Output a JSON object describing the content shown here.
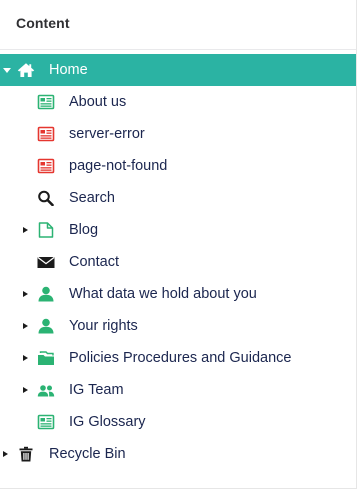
{
  "panel": {
    "title": "Content"
  },
  "tree": {
    "home": {
      "label": "Home",
      "icon": "home-icon",
      "expanded": true,
      "selected": true
    },
    "children": [
      {
        "label": "About us",
        "icon": "page-icon"
      },
      {
        "label": "server-error",
        "icon": "error-page-icon"
      },
      {
        "label": "page-not-found",
        "icon": "error-page-icon"
      },
      {
        "label": "Search",
        "icon": "search-icon"
      },
      {
        "label": "Blog",
        "icon": "document-icon",
        "has_children": true
      },
      {
        "label": "Contact",
        "icon": "envelope-icon"
      },
      {
        "label": "What data we hold about you",
        "icon": "user-icon",
        "has_children": true
      },
      {
        "label": "Your rights",
        "icon": "user-icon",
        "has_children": true
      },
      {
        "label": "Policies Procedures and Guidance",
        "icon": "folder-icon",
        "has_children": true
      },
      {
        "label": "IG Team",
        "icon": "users-icon",
        "has_children": true
      },
      {
        "label": "IG Glossary",
        "icon": "page-icon"
      }
    ],
    "recycle_bin": {
      "label": "Recycle Bin",
      "icon": "trash-icon",
      "has_children": true
    }
  },
  "colors": {
    "selected_background": "#2bb3a3",
    "green_icon": "#2bb373",
    "red_icon": "#e5362f",
    "text": "#1b264f"
  }
}
